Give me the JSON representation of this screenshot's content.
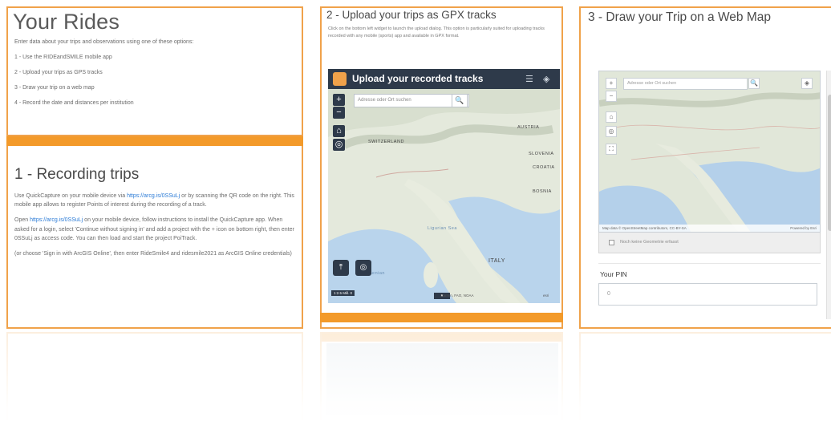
{
  "rides": {
    "title": "Your Rides",
    "intro": "Enter data about your trips and observations using one of these options:",
    "options": [
      "1 - Use the RIDEandSMILE mobile app",
      "2 - Upload your trips as GPS tracks",
      "3 - Draw your trip on a web map",
      "4 - Record the date and distances per institution"
    ]
  },
  "recording": {
    "title": "1 - Recording trips",
    "p1_pre": "Use QuickCapture on your mobile device via ",
    "p1_link": "https://arcg.is/0SSuLj",
    "p1_post": " or by scanning the QR code on the right. This mobile app allows to register Points of interest during the recording of a track.",
    "p2_pre": "Open ",
    "p2_link": "https://arcg.is/0SSuLj",
    "p2_post": " on your mobile device, follow instructions to install the QuickCapture app. When asked for a login, select 'Continue without signing in' and add a project with the + icon on bottom right, then enter 0SSuLj as access code. You can then load and start the project PoiTrack.",
    "p3": "(or choose 'Sign in with ArcGIS Online', then enter RideSmile4 and ridesmile2021 as ArcGIS Online credentials)"
  },
  "upload": {
    "title": "2 - Upload your trips as GPX tracks",
    "desc": "Click on the bottom left widget to launch the upload dialog. This option is particularly suited for uploading tracks recorded with any mobile (sports) app and available in GPX format.",
    "map_title": "Upload your recorded tracks",
    "search_placeholder": "Adresse oder Ort suchen",
    "scale": "1:2.5 Mill. 0",
    "attribution": "Garmin, FAO, NOAA",
    "esri": "esri",
    "map_labels": [
      "AUSTRIA",
      "SWITZERLAND",
      "SLOVENIA",
      "CROATIA",
      "BOSNIA",
      "ITALY",
      "Ligurian Sea",
      "Tyrrhenian"
    ]
  },
  "draw": {
    "title": "3 - Draw your Trip on a Web Map",
    "search_placeholder": "Adresse oder Ort suchen",
    "attribution": "Map data © OpenStreetMap contributors, CC-BY-SA",
    "powered": "Powered by Esri",
    "geometry_label": "Noch keine Geometrie erfasst",
    "pin_label": "Your PIN",
    "pin_value": "0"
  },
  "colors": {
    "accent": "#f39a2a",
    "border": "#f0a24a",
    "map_header": "#2e3a4a",
    "link": "#2b7bd6"
  },
  "icons": {
    "zoom_in": "+",
    "zoom_out": "−",
    "home": "⌂",
    "locate": "◎",
    "search": "🔍",
    "list": "☰",
    "layers": "◈",
    "upload": "⤒",
    "collapse": "▾",
    "fullscreen": "⛶"
  }
}
